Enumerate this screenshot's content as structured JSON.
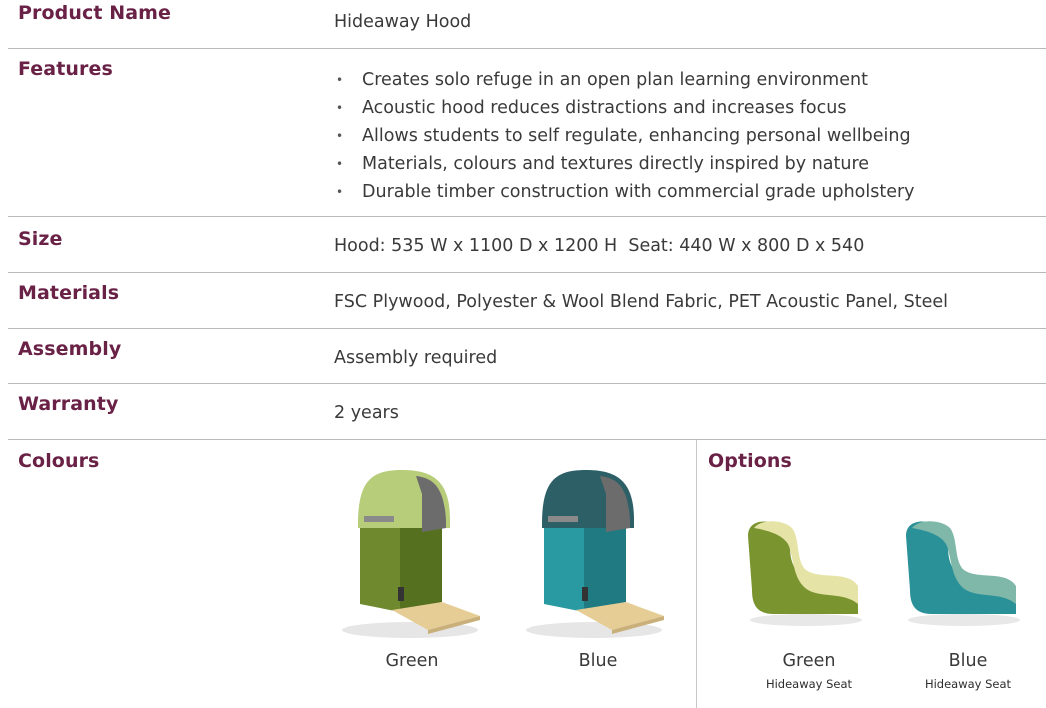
{
  "rows": {
    "product_name": {
      "label": "Product Name",
      "value": "Hideaway Hood"
    },
    "features": {
      "label": "Features",
      "items": [
        "Creates solo refuge in an open plan learning environment",
        "Acoustic hood reduces distractions and increases focus",
        "Allows students to self regulate, enhancing personal wellbeing",
        "Materials, colours and textures directly inspired by nature",
        "Durable timber construction with commercial grade upholstery"
      ]
    },
    "size": {
      "label": "Size",
      "value": "Hood: 535 W x 1100 D x 1200 H  Seat: 440 W x 800 D x 540"
    },
    "materials": {
      "label": "Materials",
      "value": "FSC Plywood, Polyester & Wool Blend Fabric, PET Acoustic Panel, Steel"
    },
    "assembly": {
      "label": "Assembly",
      "value": "Assembly required"
    },
    "warranty": {
      "label": "Warranty",
      "value": "2 years"
    }
  },
  "colours": {
    "label": "Colours",
    "items": [
      {
        "name": "Green",
        "hood": "#b7cd7a",
        "panel": "#6f8a2e",
        "shade": "#55701f"
      },
      {
        "name": "Blue",
        "hood": "#2c5f66",
        "panel": "#2a9aa2",
        "shade": "#1f7a82"
      }
    ]
  },
  "options": {
    "label": "Options",
    "items": [
      {
        "name": "Green",
        "sub": "Hideaway Seat",
        "top": "#e6e3a6",
        "side": "#7a9430"
      },
      {
        "name": "Blue",
        "sub": "Hideaway Seat",
        "top": "#7fb7a8",
        "side": "#2a9199"
      }
    ]
  },
  "colors": {
    "label": "#6a2146",
    "divider": "#b9b9b9"
  }
}
